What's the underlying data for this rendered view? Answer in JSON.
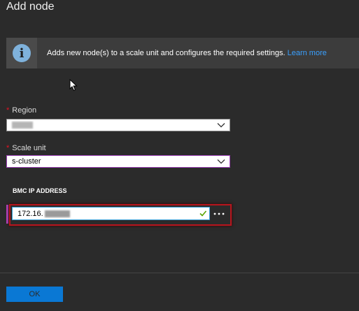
{
  "blade": {
    "title": "Add node"
  },
  "info": {
    "icon": "info-icon",
    "message": "Adds new node(s) to a scale unit and configures the required settings.",
    "link_label": "Learn more",
    "link_color": "#3aa0ff"
  },
  "form": {
    "required_marker": "*",
    "region": {
      "label": "Region",
      "value": ""
    },
    "scale_unit": {
      "label": "Scale unit",
      "value": "s-cluster"
    },
    "bmc": {
      "section_label": "BMC IP ADDRESS",
      "value": "172.16."
    }
  },
  "actions": {
    "ok_label": "OK"
  },
  "colors": {
    "accent_purple": "#b848c6",
    "highlight_red": "#b8151d",
    "primary_blue": "#0a78d4",
    "required_red": "#e81123"
  }
}
